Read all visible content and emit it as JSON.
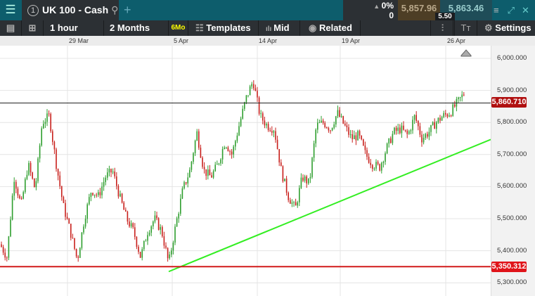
{
  "header": {
    "menu_icon": "hamburger-icon",
    "tab_number": "1",
    "instrument": "UK 100 - Cash",
    "change_pct": "0%",
    "change_abs": "0",
    "bid": "5,857.96",
    "ask": "5,863.46",
    "spread": "5.50"
  },
  "toolbar": {
    "interval": "1 hour",
    "range": "2 Months",
    "range_badge": "6Mo",
    "templates": "Templates",
    "price_type": "Mid",
    "related": "Related",
    "settings": "Settings"
  },
  "chart_data": {
    "type": "candlestick",
    "x_ticks": [
      "29 Mar",
      "5 Apr",
      "14 Apr",
      "19 Apr",
      "26 Apr"
    ],
    "y_ticks": [
      "6,000.000",
      "5,900.000",
      "5,800.000",
      "5,700.000",
      "5,600.000",
      "5,500.000",
      "5,400.000",
      "5,300.000"
    ],
    "ylim": [
      5280,
      6040
    ],
    "price_path": [
      5420,
      5380,
      5630,
      5540,
      5670,
      5590,
      5800,
      5820,
      5670,
      5540,
      5460,
      5370,
      5500,
      5590,
      5570,
      5630,
      5650,
      5570,
      5500,
      5460,
      5380,
      5460,
      5500,
      5460,
      5360,
      5480,
      5590,
      5650,
      5770,
      5650,
      5630,
      5670,
      5740,
      5700,
      5790,
      5875,
      5930,
      5820,
      5790,
      5780,
      5650,
      5570,
      5530,
      5630,
      5610,
      5790,
      5800,
      5780,
      5830,
      5790,
      5750,
      5760,
      5700,
      5670,
      5660,
      5720,
      5770,
      5780,
      5760,
      5820,
      5750,
      5770,
      5800,
      5820,
      5830,
      5860
    ],
    "current_price": "5,860.710",
    "support_level": "5,350.312",
    "trendline": {
      "from": 5335,
      "to": 5747
    },
    "colors": {
      "up": "#2e9e2e",
      "down": "#c8201c",
      "trend": "#33ee22",
      "support": "#d11a1a",
      "current": "#b01010"
    }
  }
}
